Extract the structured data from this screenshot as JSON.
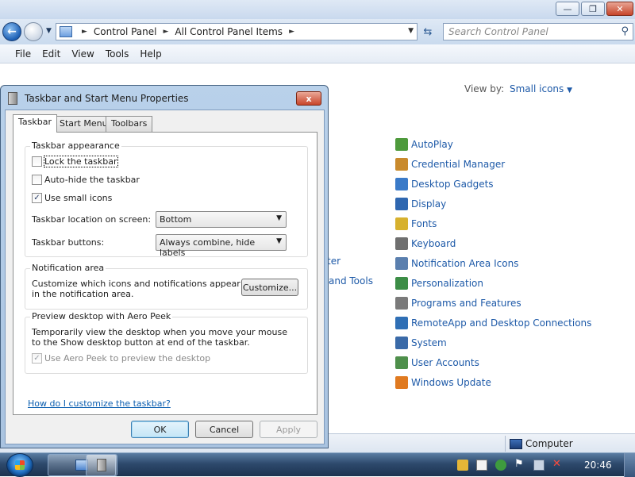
{
  "control_panel": {
    "address": {
      "crumbs": [
        "Control Panel",
        "All Control Panel Items"
      ]
    },
    "search_placeholder": "Search Control Panel",
    "menu": [
      "File",
      "Edit",
      "View",
      "Tools",
      "Help"
    ],
    "view_by_label": "View by:",
    "view_by_value": "Small icons",
    "partial_items": [
      "ter",
      "and Tools"
    ],
    "items": [
      {
        "label": "AutoPlay",
        "color": "#4e9a3c"
      },
      {
        "label": "Credential Manager",
        "color": "#c98a2c"
      },
      {
        "label": "Desktop Gadgets",
        "color": "#3a7ac8"
      },
      {
        "label": "Display",
        "color": "#2f67b0"
      },
      {
        "label": "Fonts",
        "color": "#d7b12e"
      },
      {
        "label": "Keyboard",
        "color": "#6f6f6f"
      },
      {
        "label": "Notification Area Icons",
        "color": "#5a7fae"
      },
      {
        "label": "Personalization",
        "color": "#3c8d46"
      },
      {
        "label": "Programs and Features",
        "color": "#7a7a7a"
      },
      {
        "label": "RemoteApp and Desktop Connections",
        "color": "#2f6fb5"
      },
      {
        "label": "System",
        "color": "#3a6aa8"
      },
      {
        "label": "User Accounts",
        "color": "#4e8f4b"
      },
      {
        "label": "Windows Update",
        "color": "#e07a20"
      }
    ],
    "status_computer": "Computer"
  },
  "dialog": {
    "title": "Taskbar and Start Menu Properties",
    "close_symbol": "x",
    "tabs": [
      "Taskbar",
      "Start Menu",
      "Toolbars"
    ],
    "appearance": {
      "label": "Taskbar appearance",
      "lock": {
        "label": "Lock the taskbar",
        "checked": false
      },
      "autohide": {
        "label": "Auto-hide the taskbar",
        "checked": false
      },
      "small_icons": {
        "label": "Use small icons",
        "checked": true
      },
      "location_label": "Taskbar location on screen:",
      "location_value": "Bottom",
      "buttons_label": "Taskbar buttons:",
      "buttons_value": "Always combine, hide labels"
    },
    "notification": {
      "label": "Notification area",
      "text": "Customize which icons and notifications appear in the notification area.",
      "button": "Customize..."
    },
    "aero_peek": {
      "label": "Preview desktop with Aero Peek",
      "text": "Temporarily view the desktop when you move your mouse to the Show desktop button at end of the taskbar.",
      "checkbox": {
        "label": "Use Aero Peek to preview the desktop",
        "checked": true,
        "disabled": true
      }
    },
    "help_link": "How do I customize the taskbar?",
    "buttons": {
      "ok": "OK",
      "cancel": "Cancel",
      "apply": "Apply"
    }
  },
  "taskbar": {
    "time": "20:46"
  }
}
